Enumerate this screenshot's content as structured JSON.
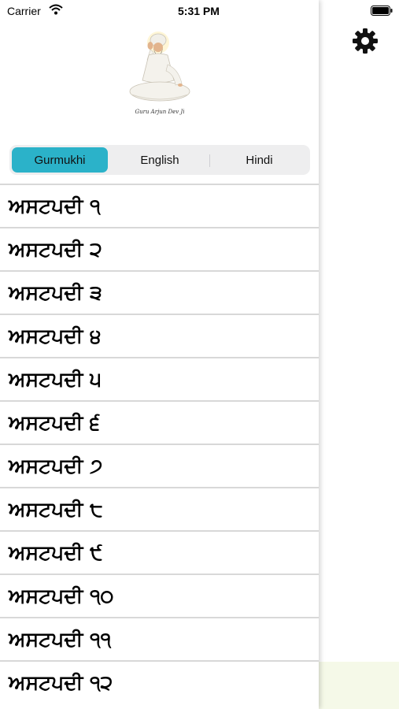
{
  "status_bar": {
    "carrier": "Carrier",
    "time": "5:31 PM"
  },
  "logo": {
    "caption": "Guru Arjun Dev Ji"
  },
  "segments": [
    {
      "label": "Gurmukhi",
      "selected": true
    },
    {
      "label": "English",
      "selected": false
    },
    {
      "label": "Hindi",
      "selected": false
    }
  ],
  "list": {
    "items": [
      {
        "label": "ਅਸਟਪਦੀ ੧"
      },
      {
        "label": "ਅਸਟਪਦੀ ੨"
      },
      {
        "label": "ਅਸਟਪਦੀ ੩"
      },
      {
        "label": "ਅਸਟਪਦੀ ੪"
      },
      {
        "label": "ਅਸਟਪਦੀ ੫"
      },
      {
        "label": "ਅਸਟਪਦੀ ੬"
      },
      {
        "label": "ਅਸਟਪਦੀ ੭"
      },
      {
        "label": "ਅਸਟਪਦੀ ੮"
      },
      {
        "label": "ਅਸਟਪਦੀ ੯"
      },
      {
        "label": "ਅਸਟਪਦੀ ੧੦"
      },
      {
        "label": "ਅਸਟਪਦੀ ੧੧"
      },
      {
        "label": "ਅਸਟਪਦੀ ੧੨"
      }
    ]
  },
  "colors": {
    "accent": "#2bb2c9",
    "background": "#ffffff",
    "divider": "#d8d8d8"
  },
  "icons": [
    "wifi-icon",
    "battery-icon",
    "gear-icon"
  ]
}
